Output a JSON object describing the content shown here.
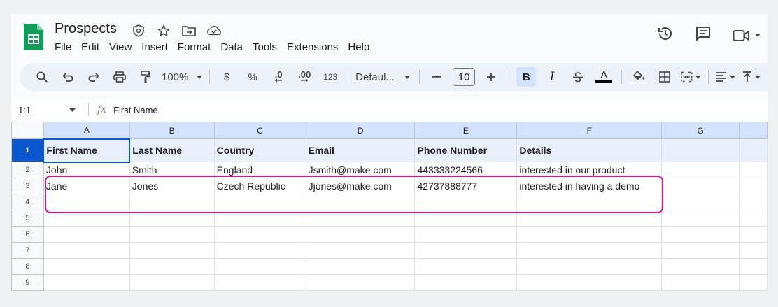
{
  "doc": {
    "title": "Prospects"
  },
  "menu": [
    "File",
    "Edit",
    "View",
    "Insert",
    "Format",
    "Data",
    "Tools",
    "Extensions",
    "Help"
  ],
  "toolbar": {
    "zoom": "100%",
    "currency": "$",
    "percent": "%",
    "dec_decrease": ".0",
    "dec_increase": ".00",
    "number_format": "123",
    "font": "Defaul...",
    "font_size": "10",
    "bold": "B",
    "italic": "I",
    "text_color_letter": "A"
  },
  "formula_bar": {
    "cell_ref": "1:1",
    "fx": "fx",
    "content": "First Name"
  },
  "columns": [
    "A",
    "B",
    "C",
    "D",
    "E",
    "F",
    "G"
  ],
  "rows": [
    {
      "num": "1",
      "cells": [
        "First Name",
        "Last Name",
        "Country",
        "Email",
        "Phone Number",
        "Details",
        ""
      ]
    },
    {
      "num": "2",
      "cells": [
        "John",
        "Smith",
        "England",
        "Jsmith@make.com",
        "443333224566",
        "interested in our product",
        ""
      ]
    },
    {
      "num": "3",
      "cells": [
        "Jane",
        "Jones",
        "Czech Republic",
        "Jjones@make.com",
        "42737888777",
        "interested in having a demo",
        ""
      ]
    },
    {
      "num": "4",
      "cells": [
        "",
        "",
        "",
        "",
        "",
        "",
        ""
      ]
    },
    {
      "num": "5",
      "cells": [
        "",
        "",
        "",
        "",
        "",
        "",
        ""
      ]
    },
    {
      "num": "6",
      "cells": [
        "",
        "",
        "",
        "",
        "",
        "",
        ""
      ]
    },
    {
      "num": "7",
      "cells": [
        "",
        "",
        "",
        "",
        "",
        "",
        ""
      ]
    },
    {
      "num": "8",
      "cells": [
        "",
        "",
        "",
        "",
        "",
        "",
        ""
      ]
    },
    {
      "num": "9",
      "cells": [
        "",
        "",
        "",
        "",
        "",
        "",
        ""
      ]
    }
  ],
  "colors": {
    "selection": "#0b57d0",
    "highlight": "#e2148e",
    "sheets_green": "#0f9d58"
  }
}
